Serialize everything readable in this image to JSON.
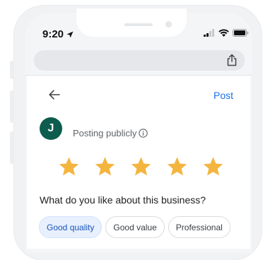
{
  "status_bar": {
    "time": "9:20"
  },
  "header": {
    "post_label": "Post"
  },
  "author": {
    "initial": "J",
    "posting_label": "Posting publicly"
  },
  "rating": {
    "stars": 5,
    "max": 5
  },
  "question": "What do you like about this business?",
  "chips": [
    {
      "label": "Good quality",
      "selected": true
    },
    {
      "label": "Good value",
      "selected": false
    },
    {
      "label": "Professional",
      "selected": false
    }
  ],
  "colors": {
    "accent": "#1a73e8",
    "star": "#f4b53f",
    "avatar": "#0d5c4d",
    "chip_selected_bg": "#e8f0fe"
  },
  "icons": {
    "location_arrow": "location-arrow-icon",
    "signal": "signal-icon",
    "wifi": "wifi-icon",
    "battery": "battery-icon",
    "share": "share-icon",
    "back": "arrow-back-icon",
    "info": "info-icon",
    "star": "star-icon"
  }
}
